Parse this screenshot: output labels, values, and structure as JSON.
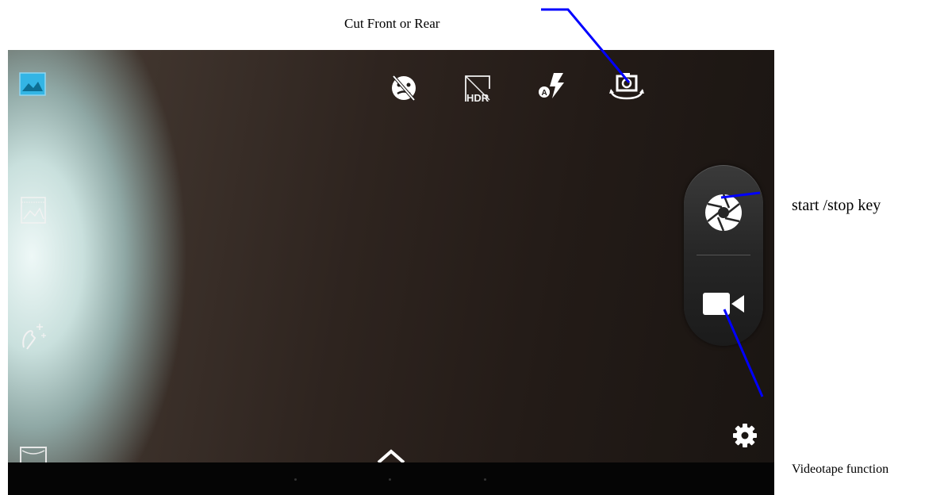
{
  "annotations": {
    "cut_front_rear": "Cut Front or Rear",
    "start_stop": "start /stop key",
    "videotape": "Videotape function"
  },
  "icons": {
    "gallery": "gallery-icon",
    "panorama": "panorama-icon",
    "face_beauty": "face-beauty-icon",
    "scene_mode": "scene-mode-icon",
    "face_detect_off": "face-detect-off-icon",
    "hdr": "hdr-icon",
    "flash_auto": "flash-auto-icon",
    "switch_camera": "switch-camera-icon",
    "shutter": "shutter-icon",
    "video": "video-camera-icon",
    "expand": "chevron-up-icon",
    "settings": "gear-icon"
  },
  "colors": {
    "annotation_line": "#0000ff",
    "accent": "#33b5e5"
  }
}
